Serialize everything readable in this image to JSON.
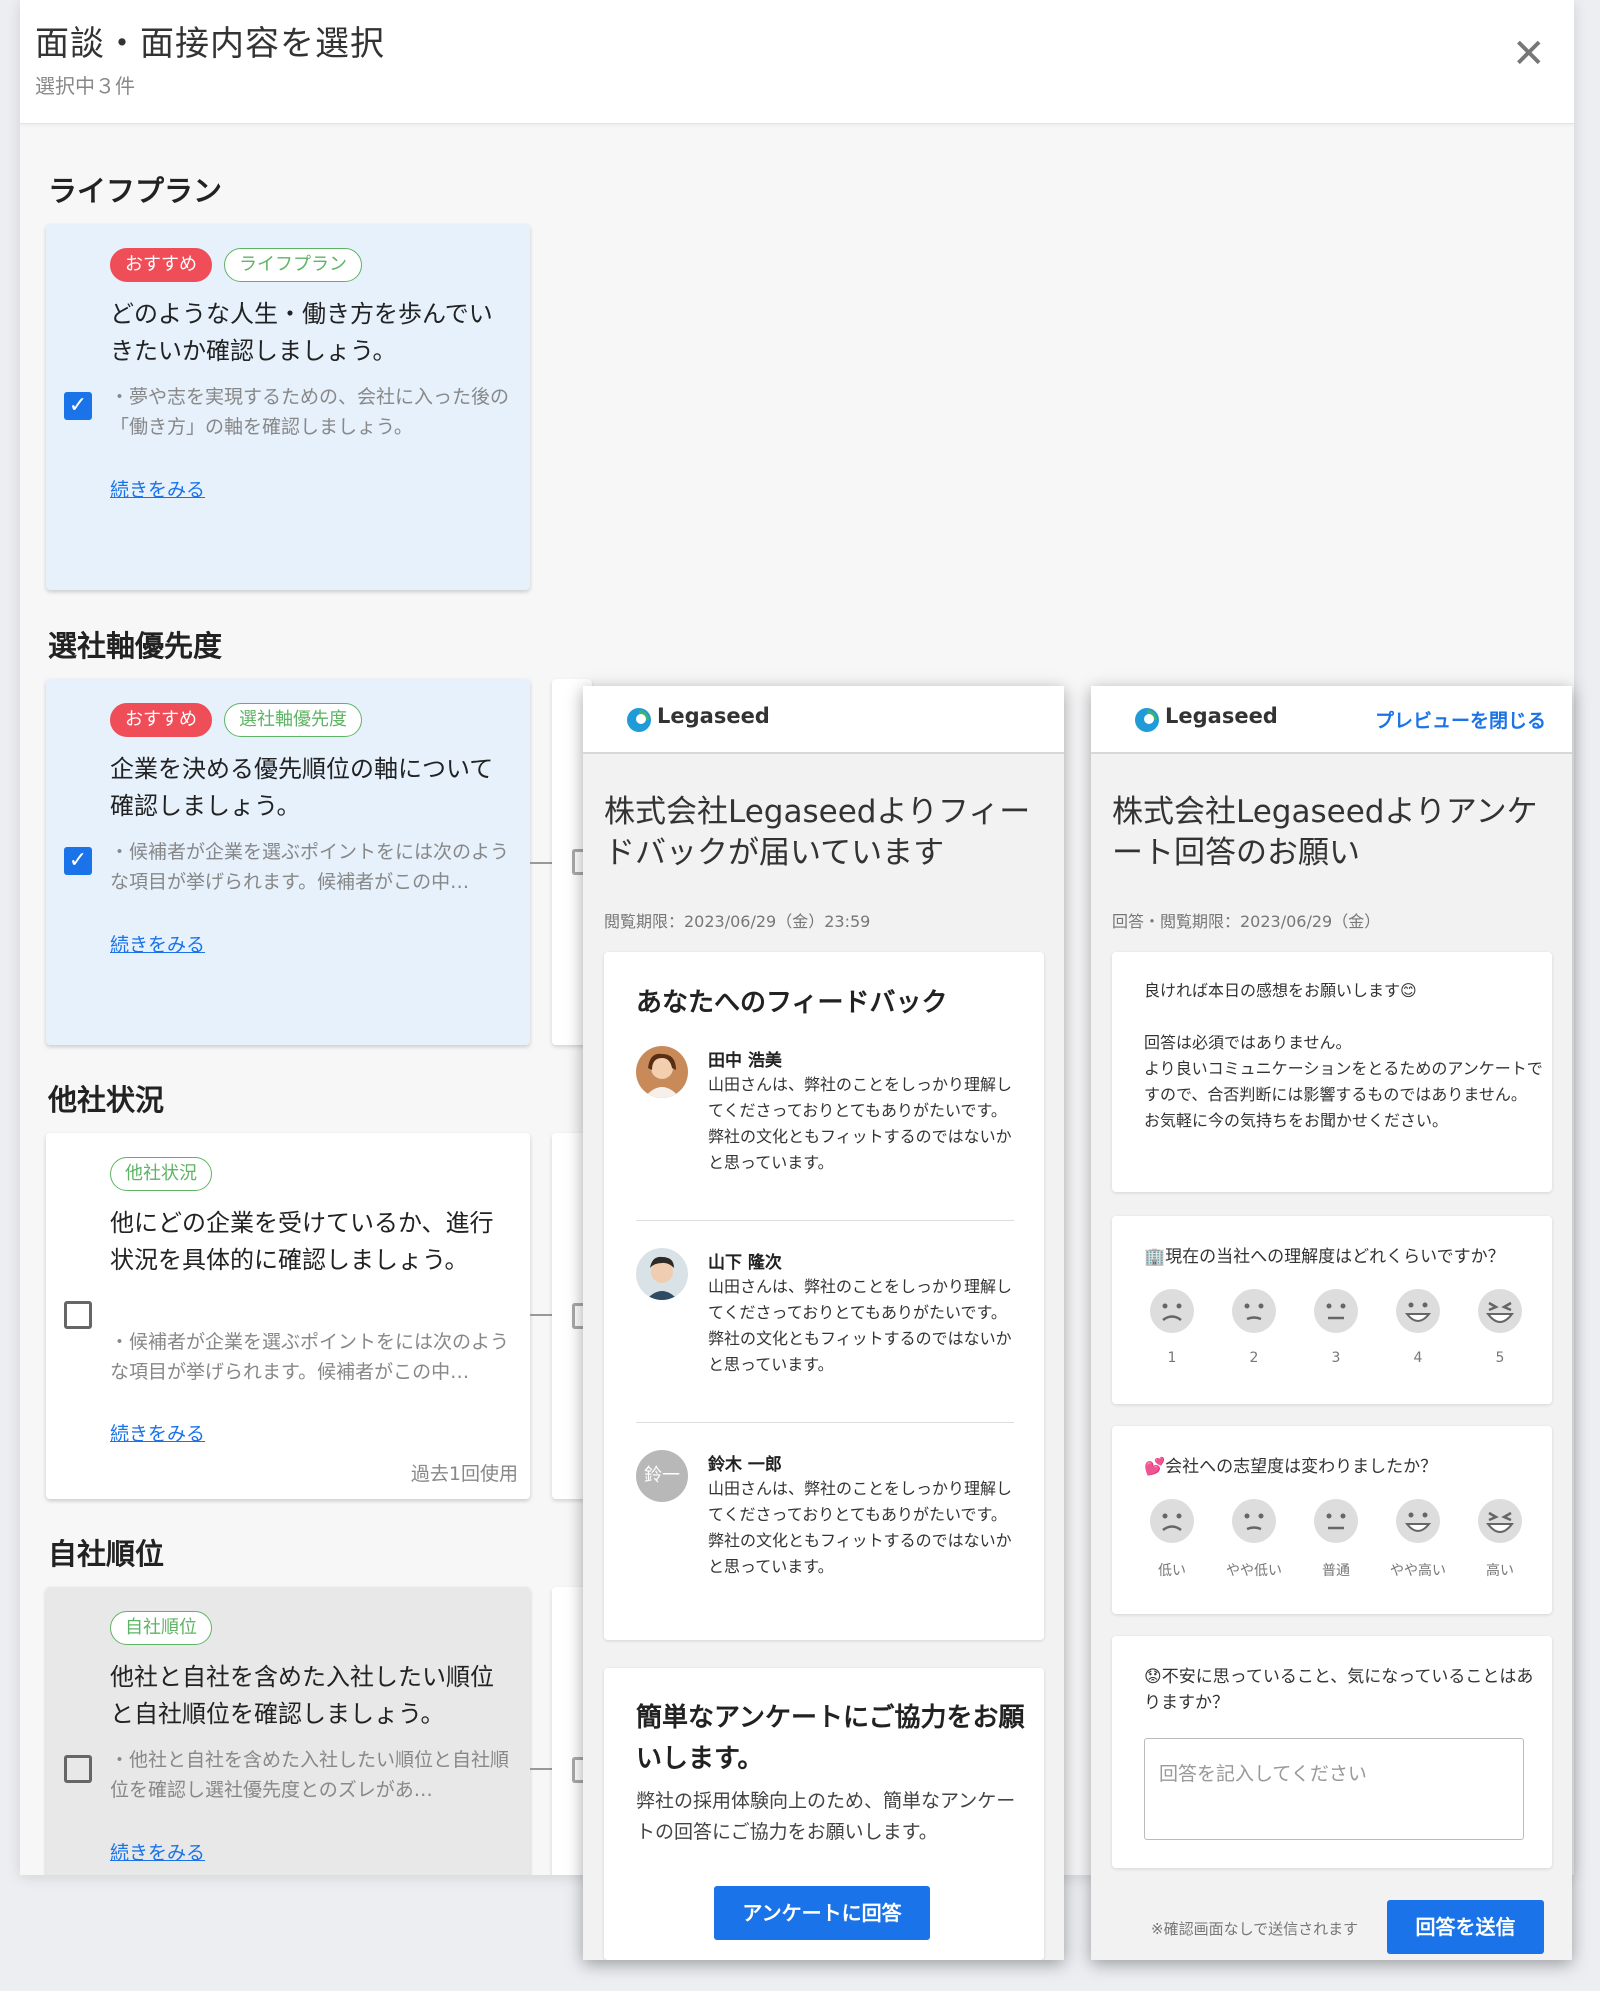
{
  "dialog": {
    "title": "面談・面接内容を選択",
    "subtitle": "選択中３件",
    "close_icon": "close-icon"
  },
  "sections": [
    {
      "heading": "ライフプラン",
      "card": {
        "tags": [
          "おすすめ",
          "ライフプラン"
        ],
        "title": "どのような人生・働き方を歩んでいきたいか確認しましょう。",
        "desc": "・夢や志を実現するための、会社に入った後の「働き方」の軸を確認しましょう。",
        "more": "続きをみる",
        "checked": true
      }
    },
    {
      "heading": "選社軸優先度",
      "card": {
        "tags": [
          "おすすめ",
          "選社軸優先度"
        ],
        "title": "企業を決める優先順位の軸について確認しましょう。",
        "desc": "・候補者が企業を選ぶポイントをには次のような項目が挙げられます。候補者がこの中…",
        "more": "続きをみる",
        "checked": true
      }
    },
    {
      "heading": "他社状況",
      "card": {
        "tags": [
          "他社状況"
        ],
        "title": "他にどの企業を受けているか、進行状況を具体的に確認しましょう。",
        "desc": "・候補者が企業を選ぶポイントをには次のような項目が挙げられます。候補者がこの中…",
        "more": "続きをみる",
        "used": "過去1回使用",
        "checked": false
      }
    },
    {
      "heading": "自社順位",
      "card": {
        "tags": [
          "自社順位"
        ],
        "title": "他社と自社を含めた入社したい順位と自社順位を確認しましょう。",
        "desc": "・他社と自社を含めた入社したい順位と自社順位を確認し選社優先度とのズレがあ…",
        "more": "続きをみる",
        "checked": false
      }
    }
  ],
  "preview_feedback": {
    "brand": "Legaseed",
    "title": "株式会社Legaseedよりフィードバックが届いています",
    "date": "閲覧期限：2023/06/29（金）23:59",
    "feedback_heading": "あなたへのフィードバック",
    "people": [
      {
        "name": "田中 浩美",
        "message": "山田さんは、弊社のことをしっかり理解してくださっておりとてもありがたいです。\n弊社の文化ともフィットするのではないかと思っています。"
      },
      {
        "name": "山下 隆次",
        "message": "山田さんは、弊社のことをしっかり理解してくださっておりとてもありがたいです。\n弊社の文化ともフィットするのではないかと思っています。"
      },
      {
        "name": "鈴木 一郎",
        "initials": "鈴一",
        "message": "山田さんは、弊社のことをしっかり理解してくださっておりとてもありがたいです。\n弊社の文化ともフィットするのではないかと思っています。"
      }
    ],
    "survey_heading": "簡単なアンケートにご協力をお願いします。",
    "survey_desc": "弊社の採用体験向上のため、簡単なアンケートの回答にご協力をお願いします。",
    "survey_button": "アンケートに回答"
  },
  "preview_survey": {
    "brand": "Legaseed",
    "close_preview": "プレビューを閉じる",
    "title": "株式会社Legaseedよりアンケート回答のお願い",
    "date": "回答・閲覧期限：2023/06/29（金）",
    "intro": "良ければ本日の感想をお願いします😊\n\n回答は必須ではありません。\nより良いコミュニケーションをとるためのアンケートですので、合否判断には影響するものではありません。\nお気軽に今の気持ちをお聞かせください。",
    "q1": "🏢現在の当社への理解度はどれくらいですか？",
    "q1_labels": [
      "1",
      "2",
      "3",
      "4",
      "5"
    ],
    "q2": "💕会社への志望度は変わりましたか？",
    "q2_labels": [
      "低い",
      "やや低い",
      "普通",
      "やや高い",
      "高い"
    ],
    "q3": "😟不安に思っていること、気になっていることはありますか？",
    "q3_placeholder": "回答を記入してください",
    "note": "※確認画面なしで送信されます",
    "submit": "回答を送信"
  },
  "colors": {
    "accent": "#1a73e8",
    "recommend_tag": "#ef4d57",
    "category_tag": "#5eb465",
    "selected_card": "#e6f1fc"
  }
}
